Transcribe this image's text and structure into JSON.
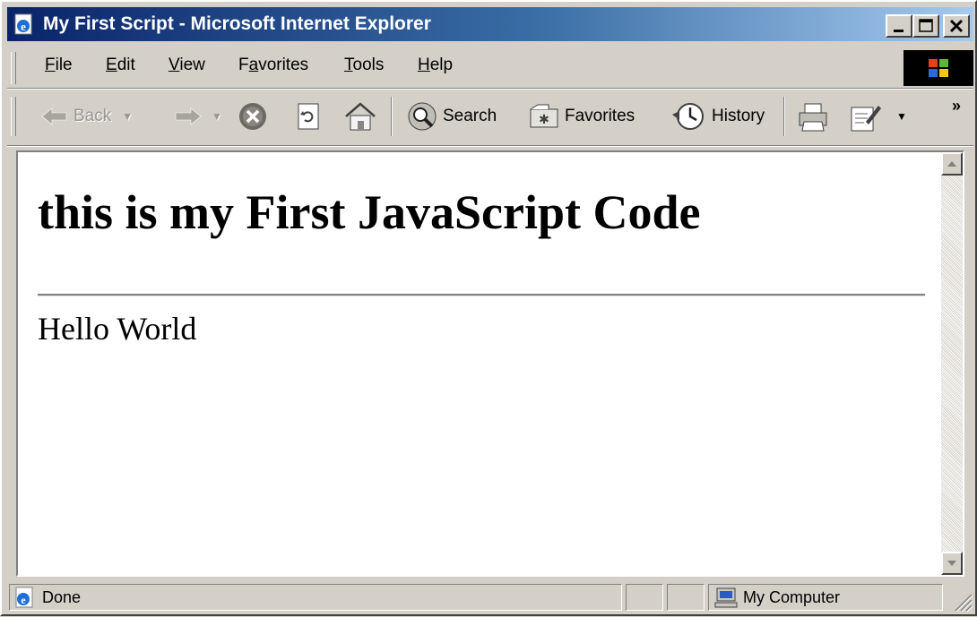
{
  "window": {
    "title": "My First Script - Microsoft Internet Explorer",
    "icon": "ie-page-icon",
    "controls": [
      "minimize-icon",
      "maximize-icon",
      "close-icon"
    ]
  },
  "menubar": {
    "items": [
      {
        "label": "File",
        "accel": "F",
        "rest": "ile"
      },
      {
        "label": "Edit",
        "accel": "E",
        "rest": "dit"
      },
      {
        "label": "View",
        "accel": "V",
        "rest": "iew"
      },
      {
        "label": "Favorites",
        "accel_prefix": "F",
        "accel": "a",
        "rest": "vorites"
      },
      {
        "label": "Tools",
        "accel": "T",
        "rest": "ools"
      },
      {
        "label": "Help",
        "accel": "H",
        "rest": "elp"
      }
    ]
  },
  "toolbar": {
    "back_label": "Back",
    "search_label": "Search",
    "favorites_label": "Favorites",
    "history_label": "History",
    "overflow": "»",
    "icons": [
      "back-arrow-icon",
      "forward-arrow-icon",
      "stop-icon",
      "refresh-icon",
      "home-icon",
      "search-icon",
      "favorites-icon",
      "history-icon",
      "print-icon",
      "edit-icon"
    ]
  },
  "page": {
    "heading": "this is my First JavaScript Code",
    "body_text": "Hello World"
  },
  "statusbar": {
    "status": "Done",
    "zone": "My Computer",
    "icons": [
      "ie-page-icon",
      "computer-icon",
      "resize-grip-icon"
    ]
  },
  "colors": {
    "titlebar_start": "#0a246a",
    "titlebar_end": "#a6caf0",
    "chrome": "#d4d0c8"
  }
}
